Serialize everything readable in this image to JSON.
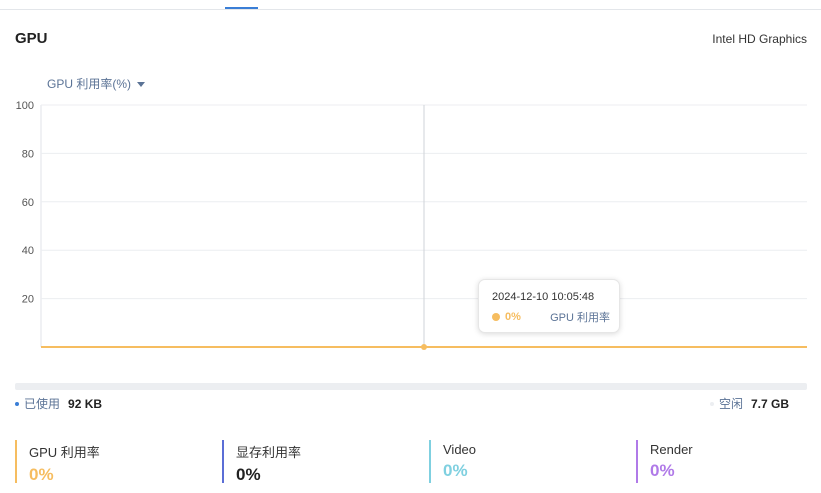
{
  "header": {
    "title": "GPU",
    "device": "Intel HD Graphics"
  },
  "metric_selector": {
    "label": "GPU 利用率(%)"
  },
  "chart_data": {
    "type": "line",
    "ylim": [
      0,
      100
    ],
    "y_ticks": [
      "100",
      "80",
      "60",
      "40",
      "20"
    ],
    "grid": true,
    "series": [
      {
        "color": "#f6bd60",
        "values": [
          0,
          0,
          0,
          0,
          0,
          0,
          0,
          0,
          0,
          0,
          0,
          0,
          0,
          0,
          0,
          0,
          0,
          0,
          0,
          0,
          0
        ]
      }
    ],
    "hover_index": 10
  },
  "tooltip": {
    "time": "2024-12-10 10:05:48",
    "value": "0%",
    "name": "GPU 利用率",
    "color": "#f6bd60"
  },
  "memory": {
    "used_label": "已使用",
    "used_value": "92 KB",
    "free_label": "空闲",
    "free_value": "7.7 GB",
    "used_fraction": 0.0,
    "used_color": "#3a7ed6"
  },
  "stats": [
    {
      "label": "GPU 利用率",
      "value": "0%",
      "color": "#f6bd60"
    },
    {
      "label": "显存利用率",
      "value": "0%",
      "color": "#5b6ed6"
    },
    {
      "label": "Video",
      "value": "0%",
      "color": "#7fd0e0"
    },
    {
      "label": "Render",
      "value": "0%",
      "color": "#b07ae8"
    }
  ]
}
